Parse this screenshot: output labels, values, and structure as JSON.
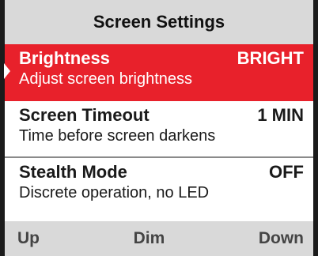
{
  "title": "Screen Settings",
  "menu": {
    "items": [
      {
        "label": "Brightness",
        "value": "BRIGHT",
        "description": "Adjust screen brightness",
        "selected": true
      },
      {
        "label": "Screen Timeout",
        "value": "1 MIN",
        "description": "Time before screen darkens",
        "selected": false
      },
      {
        "label": "Stealth Mode",
        "value": "OFF",
        "description": "Discrete operation, no LED",
        "selected": false
      }
    ]
  },
  "softkeys": {
    "left": "Up",
    "center": "Dim",
    "right": "Down"
  },
  "colors": {
    "selected_background": "#e8212b",
    "bar_background": "#d9d9d9"
  }
}
